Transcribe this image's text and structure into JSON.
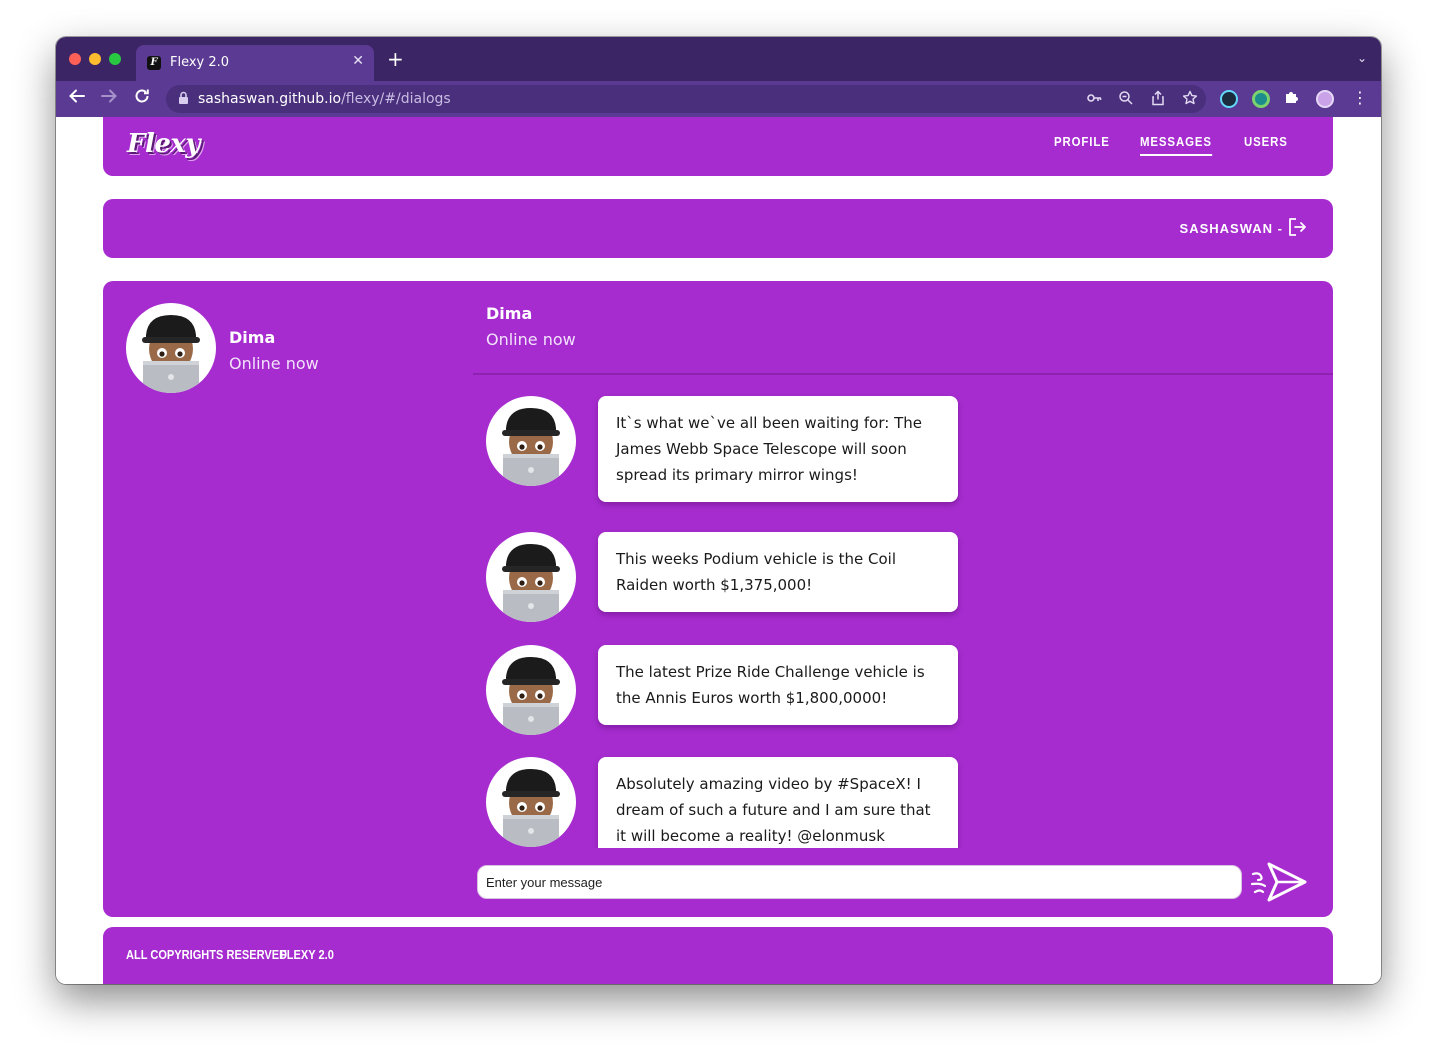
{
  "browser": {
    "tab_title": "Flexy 2.0",
    "tab_favicon": "F",
    "url_host": "sashaswan.github.io",
    "url_path": "/flexy/#/dialogs",
    "icons": [
      "back-icon",
      "forward-icon",
      "reload-icon",
      "lock-icon",
      "key-icon",
      "zoom-icon",
      "share-icon",
      "star-icon",
      "react-devtools-icon",
      "extension-circle-icon",
      "puzzle-icon",
      "profile-avatar-icon",
      "more-icon"
    ]
  },
  "header": {
    "logo": "Flexy",
    "nav": {
      "profile": "PROFILE",
      "messages": "MESSAGES",
      "users": "USERS"
    }
  },
  "userbar": {
    "username": "SASHASWAN -"
  },
  "dialogs": [
    {
      "name": "Dima",
      "status": "Online now"
    }
  ],
  "chat": {
    "name": "Dima",
    "status": "Online now",
    "messages": [
      {
        "text": "It`s what we`ve all been waiting for: The James Webb Space Telescope will soon spread its primary mirror wings!"
      },
      {
        "text": "This weeks Podium vehicle is the Coil Raiden worth $1,375,000!"
      },
      {
        "text": "The latest Prize Ride Challenge vehicle is the Annis Euros worth $1,800,0000!"
      },
      {
        "text": "Absolutely amazing video by #SpaceX! I dream of such a future and I am sure that it will become a reality! @elonmusk"
      }
    ],
    "input_placeholder": "Enter your message"
  },
  "footer": {
    "copyright": "ALL COPYRIGHTS RESERVED",
    "version": "FLEXY 2.0"
  },
  "colors": {
    "brand_purple": "#a62ccf",
    "chrome_dark": "#3b2565",
    "chrome_toolbar": "#5a3a92"
  }
}
